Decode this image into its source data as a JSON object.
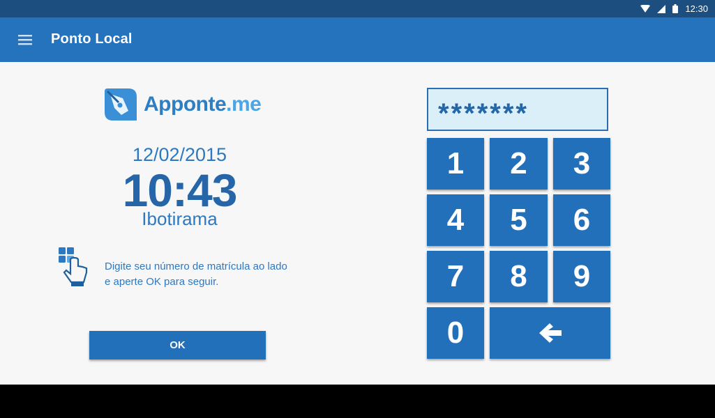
{
  "status_bar": {
    "time": "12:30",
    "icons": [
      "wifi-icon",
      "signal-icon",
      "battery-icon"
    ]
  },
  "app_bar": {
    "title": "Ponto Local",
    "menu_icon": "hamburger-menu-icon"
  },
  "logo": {
    "name": "Apponte",
    "suffix": ".me"
  },
  "clock": {
    "date": "12/02/2015",
    "time": "10:43",
    "location": "Ibotirama"
  },
  "instructions": {
    "line1": "Digite seu número de matrícula ao lado",
    "line2": "e aperte OK para seguir."
  },
  "ok_button": {
    "label": "OK"
  },
  "pin_display": {
    "value": "*******"
  },
  "keypad": {
    "keys": [
      "1",
      "2",
      "3",
      "4",
      "5",
      "6",
      "7",
      "8",
      "9",
      "0"
    ],
    "backspace_icon": "arrow-left-icon"
  },
  "colors": {
    "status_bar": "#1c4f80",
    "app_bar": "#2673bd",
    "button": "#2270ba",
    "text_accent": "#2e78c0",
    "display_bg": "#dbeff9"
  }
}
